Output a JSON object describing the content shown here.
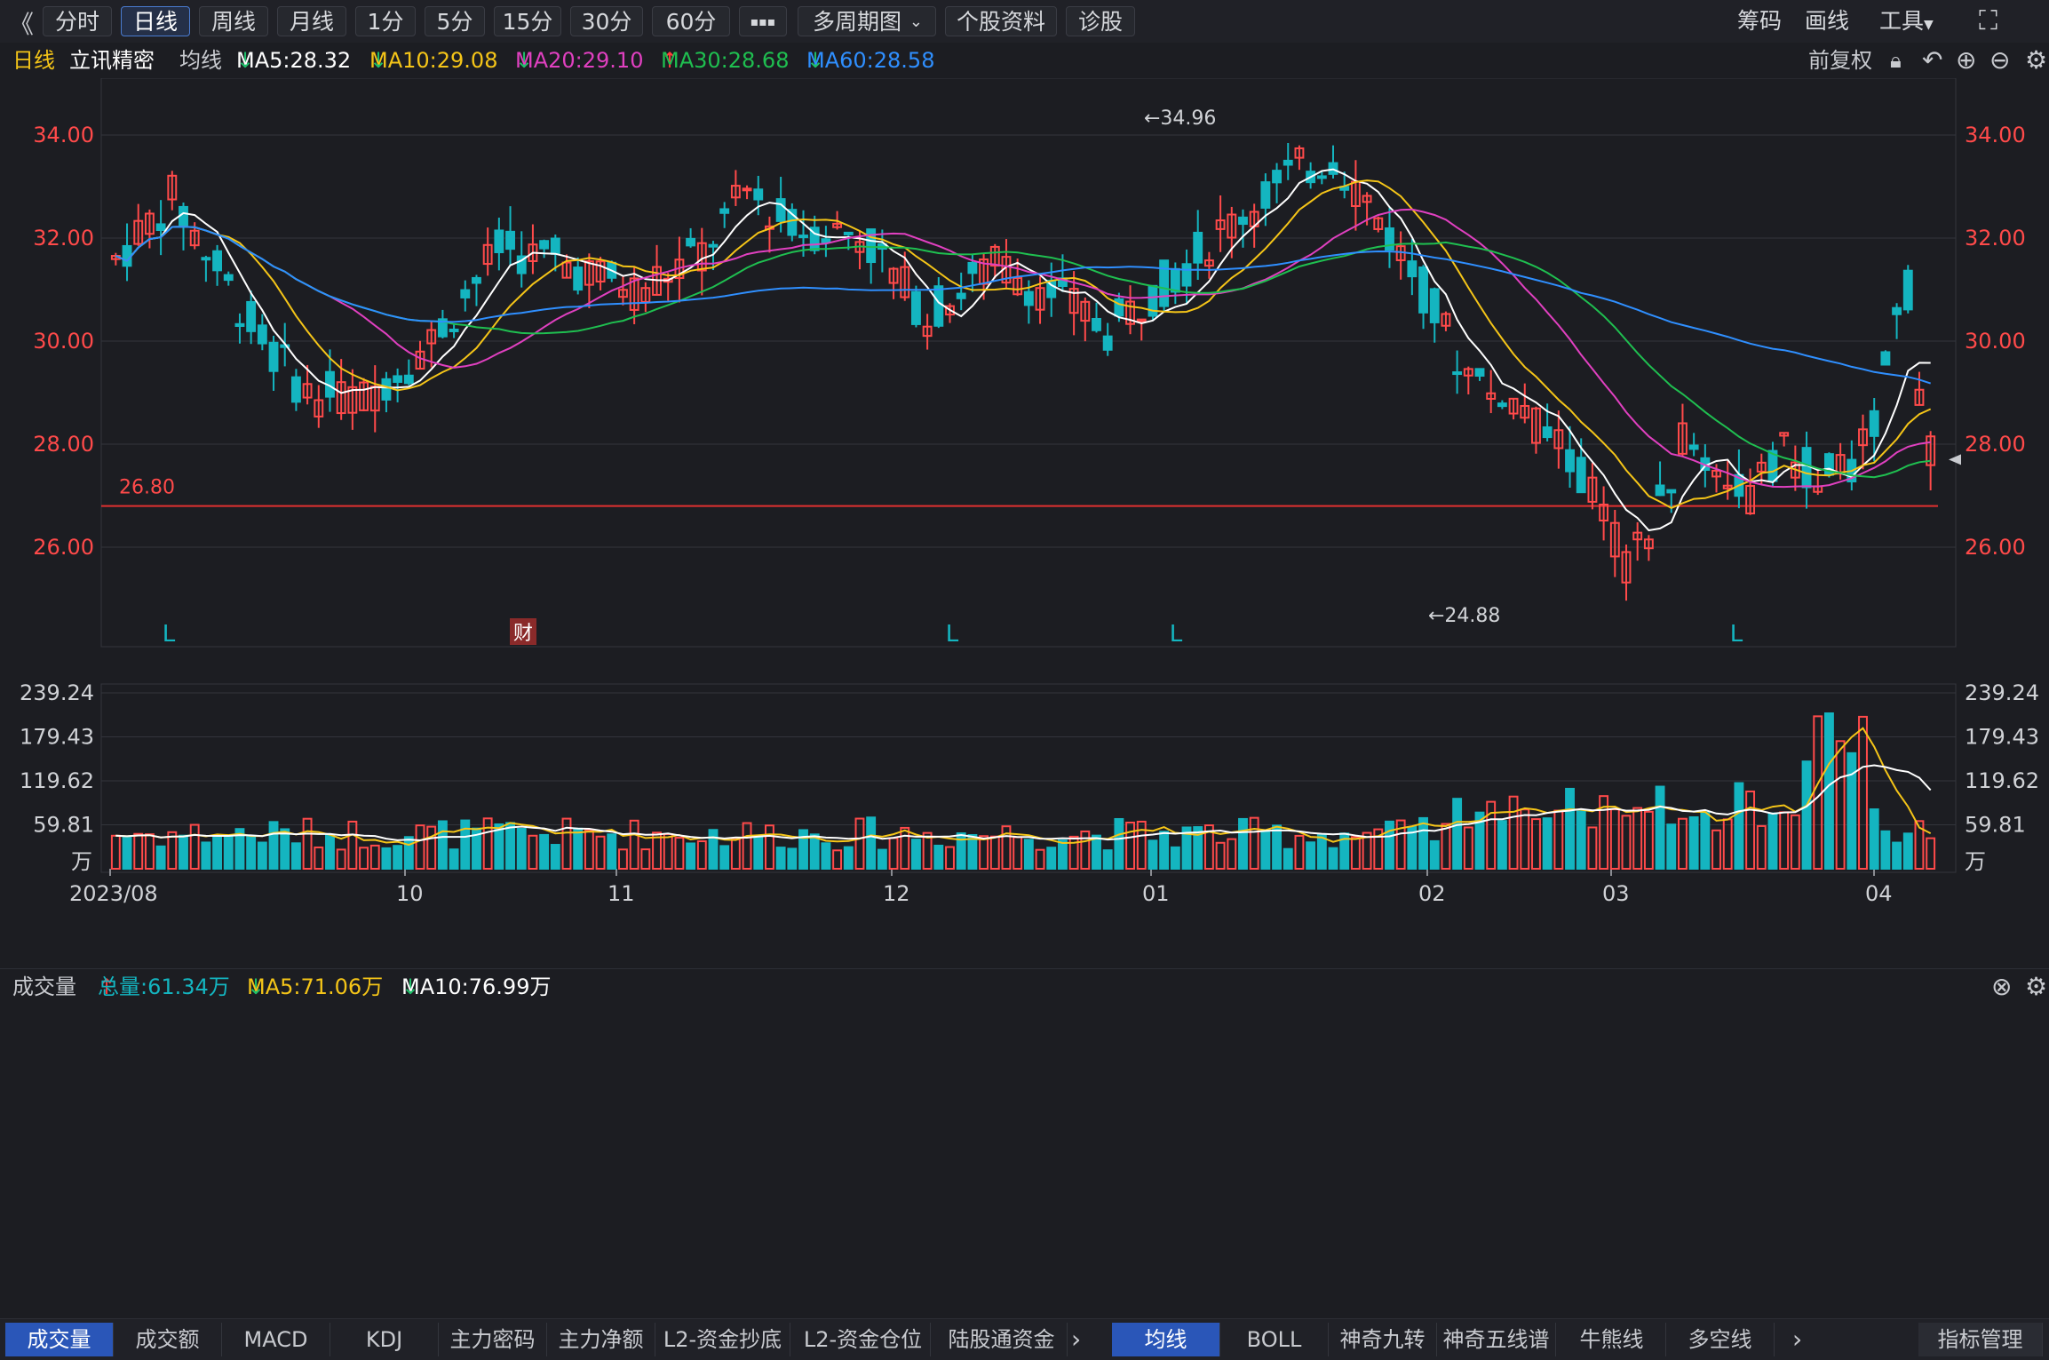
{
  "toolbar": {
    "back_icon": "double-chevron-left-icon",
    "periods": [
      "分时",
      "日线",
      "周线",
      "月线",
      "1分",
      "5分",
      "15分",
      "30分",
      "60分"
    ],
    "active_period": "日线",
    "more_glyph": "▪▪▪",
    "multi_period": "多周期图",
    "stock_info": "个股资料",
    "diagnose": "诊股",
    "right": {
      "chips": "筹码",
      "draw": "画线",
      "tools": "工具"
    }
  },
  "ma_legend": {
    "period": "日线",
    "stock_name": "立讯精密",
    "label": "均线",
    "items": [
      {
        "text": "MA5:28.32",
        "arrow": "↓",
        "color": "#ffffff",
        "arrow_color": "#1fbf6a"
      },
      {
        "text": "MA10:29.08",
        "arrow": "↓",
        "color": "#f5c518",
        "arrow_color": "#1fbf6a"
      },
      {
        "text": "MA20:29.10",
        "arrow": "↓",
        "color": "#e040c0",
        "arrow_color": "#1fbf6a"
      },
      {
        "text": "MA30:28.68",
        "arrow": "↑",
        "color": "#1fbf50",
        "arrow_color": "#ff3b3b"
      },
      {
        "text": "MA60:28.58",
        "arrow": "↓",
        "color": "#2f8fff",
        "arrow_color": "#1fbf6a"
      }
    ],
    "adjust": "前复权"
  },
  "main_chart": {
    "y_ticks": [
      "34.00",
      "32.00",
      "30.00",
      "28.00",
      "26.00"
    ],
    "high_label": "←34.96",
    "low_label": "←24.88",
    "support_line_label": "26.80",
    "markers": [
      "L",
      "财",
      "L",
      "L",
      "L"
    ]
  },
  "volume_legend": {
    "title": "成交量",
    "total": "总量:61.34万",
    "total_arrow": "↑",
    "ma5": "MA5:71.06万",
    "ma5_arrow": "↓",
    "ma10": "MA10:76.99万",
    "ma10_arrow": "↓"
  },
  "volume_chart": {
    "y_ticks": [
      "239.24",
      "179.43",
      "119.62",
      "59.81",
      "万"
    ]
  },
  "x_axis": [
    "2023/08",
    "10",
    "11",
    "12",
    "01",
    "02",
    "03",
    "04"
  ],
  "bottom_tabs_left": [
    "成交量",
    "成交额",
    "MACD",
    "KDJ",
    "主力密码",
    "主力净额",
    "L2-资金抄底",
    "L2-资金仓位",
    "陆股通资金"
  ],
  "bottom_tabs_right": [
    "均线",
    "BOLL",
    "神奇九转",
    "神奇五线谱",
    "牛熊线",
    "多空线"
  ],
  "indicator_manage": "指标管理",
  "colors": {
    "up": "#ff4a4a",
    "down": "#14b5c0",
    "bg": "#1c1d22",
    "grid": "#33353c",
    "axis_text_red": "#ff4a4a"
  }
}
